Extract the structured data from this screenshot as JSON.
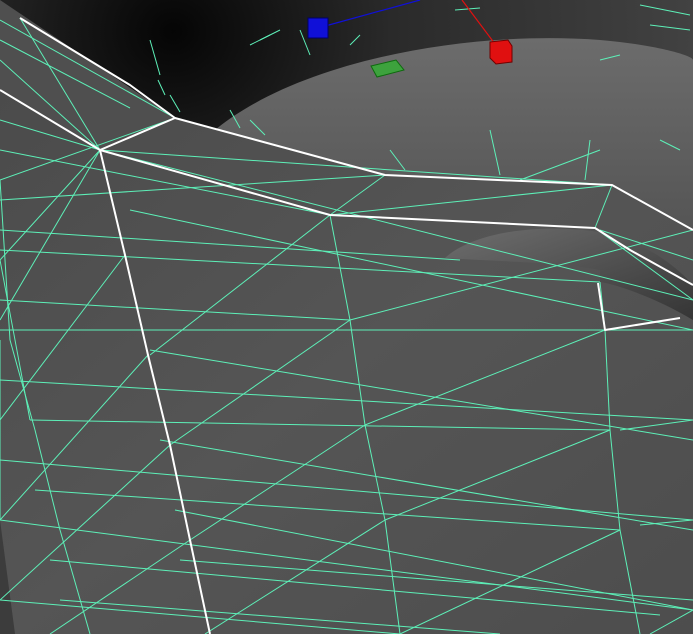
{
  "viewport": {
    "mode": "wireframe-on-shaded"
  },
  "colors": {
    "wire": "#5df0b8",
    "selected_edge": "#ffffff",
    "surface_light": "#6a6a6a",
    "surface_dark": "#2e2e2e",
    "gizmo_x": "#e01010",
    "gizmo_y": "#2fb52f",
    "gizmo_z": "#1010d8"
  },
  "gizmo": {
    "handles": [
      {
        "axis": "z",
        "icon": "z-axis-handle-icon"
      },
      {
        "axis": "x",
        "icon": "x-axis-handle-icon"
      },
      {
        "axis": "y",
        "icon": "xy-plane-handle-icon"
      }
    ]
  }
}
